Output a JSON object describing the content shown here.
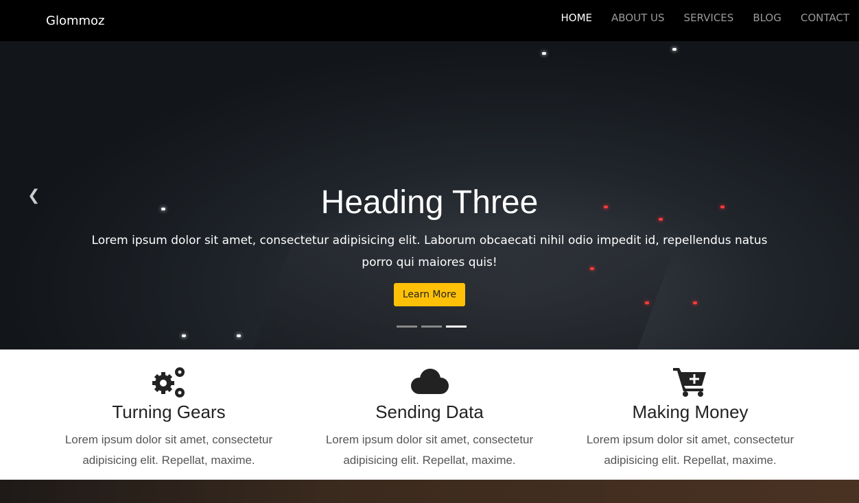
{
  "navbar": {
    "brand": "Glommoz",
    "items": [
      {
        "label": "HOME",
        "active": true
      },
      {
        "label": "ABOUT US"
      },
      {
        "label": "SERVICES"
      },
      {
        "label": "BLOG"
      },
      {
        "label": "CONTACT"
      }
    ]
  },
  "hero": {
    "heading": "Heading Three",
    "text": "Lorem ipsum dolor sit amet, consectetur adipisicing elit. Laborum obcaecati nihil odio impedit id, repellendus natus porro qui maiores quis!",
    "button": "Learn More",
    "active_slide": 3,
    "slide_count": 3
  },
  "features": [
    {
      "icon": "cogs-icon",
      "title": "Turning Gears",
      "text": "Lorem ipsum dolor sit amet, consectetur adipisicing elit. Repellat, maxime."
    },
    {
      "icon": "cloud-icon",
      "title": "Sending Data",
      "text": "Lorem ipsum dolor sit amet, consectetur adipisicing elit. Repellat, maxime."
    },
    {
      "icon": "cart-plus-icon",
      "title": "Making Money",
      "text": "Lorem ipsum dolor sit amet, consectetur adipisicing elit. Repellat, maxime."
    }
  ],
  "colors": {
    "accent": "#ffc107",
    "navbar": "#000000"
  }
}
